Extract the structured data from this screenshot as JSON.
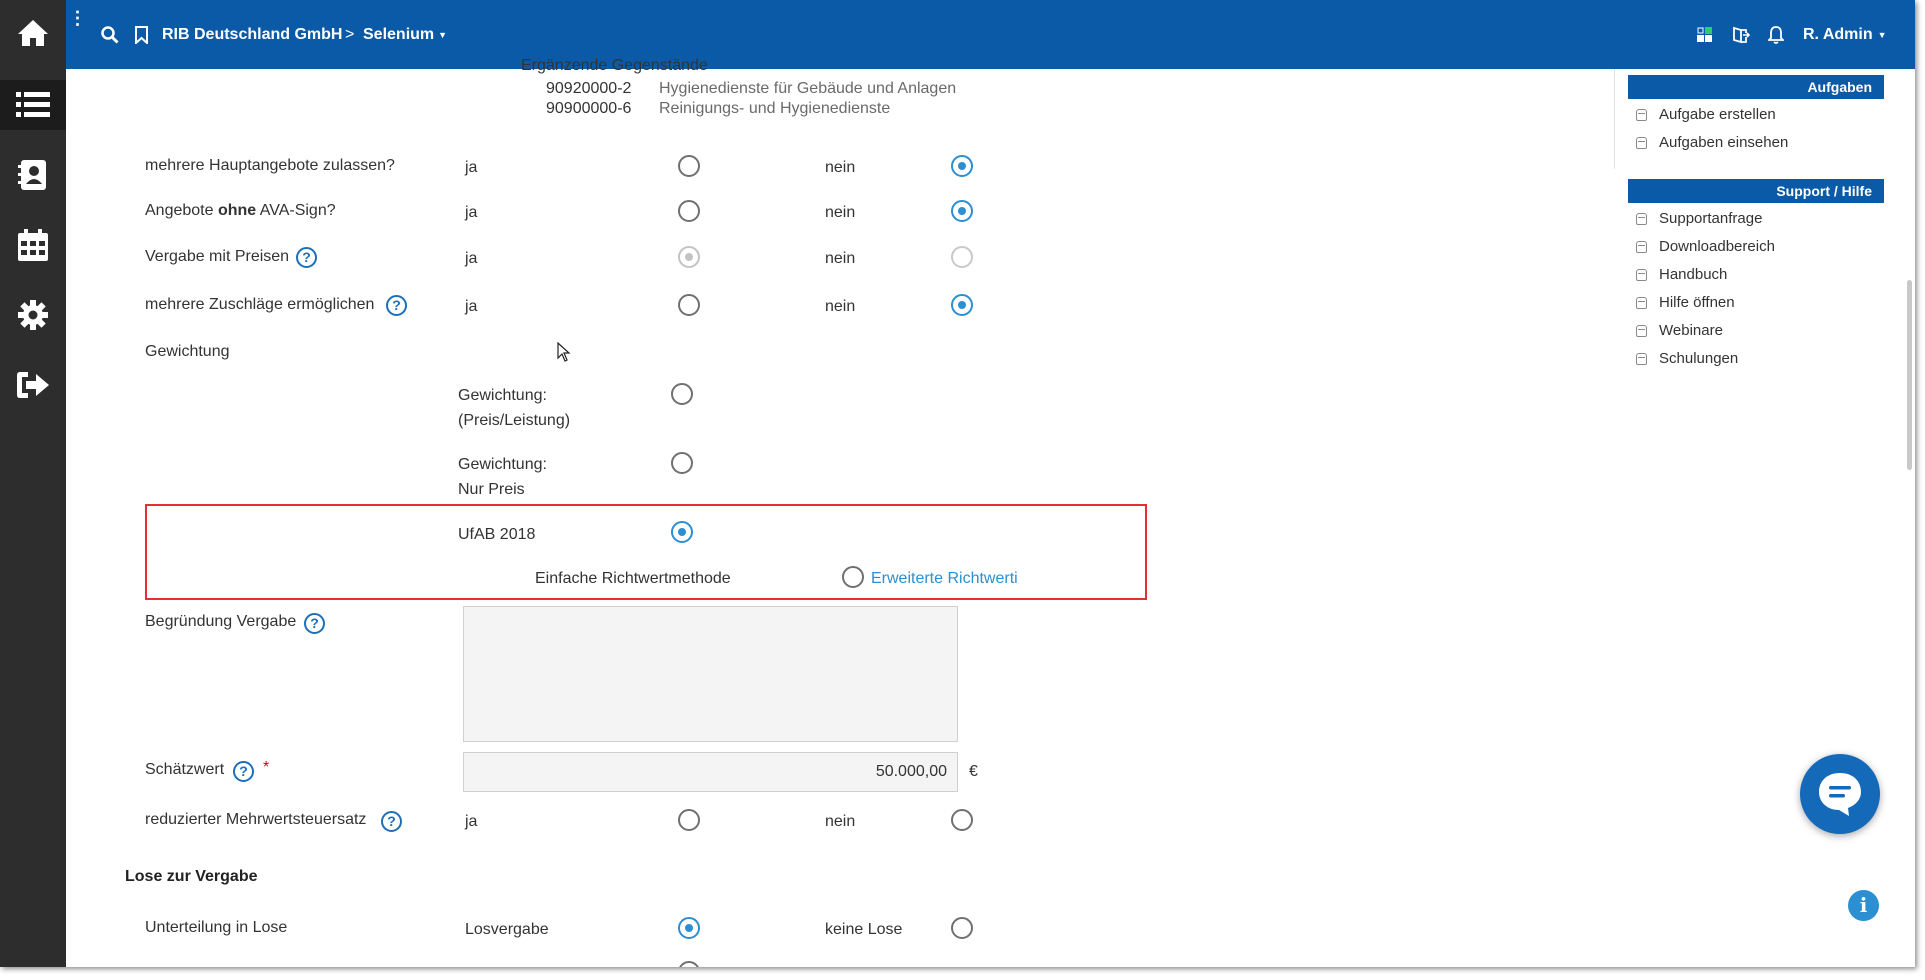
{
  "topbar": {
    "company": "RIB Deutschland GmbH",
    "separator": ">",
    "project": "Selenium",
    "user": "R. Admin",
    "dots": "⋮"
  },
  "header_partial": {
    "truncated_title": "Ergänzende Gegenstände",
    "cpv": [
      {
        "code": "90920000-2",
        "label": "Hygienedienste für Gebäude und Anlagen"
      },
      {
        "code": "90900000-6",
        "label": "Reinigungs- und Hygienedienste"
      }
    ]
  },
  "rows": {
    "hauptangebote": {
      "label": "mehrere Hauptangebote zulassen?",
      "yes": "ja",
      "no": "nein",
      "selected": "nein"
    },
    "ava_sign": {
      "label_pre": "Angebote ",
      "label_bold": "ohne",
      "label_post": " AVA-Sign?",
      "yes": "ja",
      "no": "nein",
      "selected": "nein"
    },
    "preise": {
      "label": "Vergabe mit Preisen",
      "yes": "ja",
      "no": "nein",
      "selected": "ja",
      "disabled": true
    },
    "zuschlaege": {
      "label": "mehrere Zuschläge ermöglichen",
      "yes": "ja",
      "no": "nein",
      "selected": "nein"
    }
  },
  "gewichtung": {
    "label": "Gewichtung",
    "options": [
      {
        "line1": "Gewichtung:",
        "line2": "(Preis/Leistung)",
        "selected": false
      },
      {
        "line1": "Gewichtung:",
        "line2": "Nur Preis",
        "selected": false
      },
      {
        "line1": "UfAB 2018",
        "line2": "",
        "selected": true
      }
    ],
    "sub_method_left": "Einfache Richtwertmethode",
    "sub_method_right": "Erweiterte Richtwerti"
  },
  "begruendung": {
    "label": "Begründung Vergabe",
    "value": ""
  },
  "schaetzwert": {
    "label": "Schätzwert",
    "required_mark": "*",
    "value": "50.000,00",
    "currency": "€"
  },
  "mwst": {
    "label": "reduzierter Mehrwertsteuersatz",
    "yes": "ja",
    "no": "nein",
    "selected": "none"
  },
  "lose": {
    "section_title": "Lose zur Vergabe",
    "label": "Unterteilung in Lose",
    "yes": "Losvergabe",
    "no": "keine Lose",
    "selected": "Losvergabe"
  },
  "help_glyph": "?",
  "sidebar": {
    "aufgaben_title": "Aufgaben",
    "aufgaben_items": [
      "Aufgabe erstellen",
      "Aufgaben einsehen"
    ],
    "support_title": "Support / Hilfe",
    "support_items": [
      "Supportanfrage",
      "Downloadbereich",
      "Handbuch",
      "Hilfe öffnen",
      "Webinare",
      "Schulungen"
    ]
  },
  "info_glyph": "i",
  "colors": {
    "brand": "#0a5aa8",
    "accent": "#2b8fd1",
    "highlight": "#e53030",
    "sidebar_dark": "#2d2d2d"
  },
  "icons": [
    "home-icon",
    "list-icon",
    "contacts-icon",
    "calendar-icon",
    "settings-icon",
    "logout-icon",
    "search-icon",
    "bookmark-icon",
    "grid-icon",
    "export-icon",
    "bell-icon",
    "chat-icon",
    "info-icon"
  ]
}
